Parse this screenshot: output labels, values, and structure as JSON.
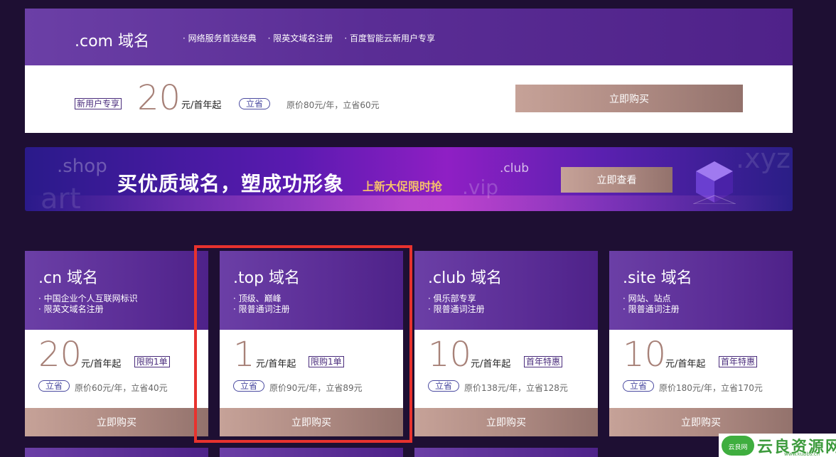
{
  "com_card": {
    "title": ".com 域名",
    "features": [
      "网络服务首选经典",
      "限英文域名注册",
      "百度智能云新用户专享"
    ],
    "badge": "新用户专享",
    "price": "20",
    "unit": "元/首年起",
    "save_label": "立省",
    "original": "原价80元/年，立省60元",
    "buy_label": "立即购买"
  },
  "banner": {
    "title": "买优质域名，塑成功形象",
    "subtitle": "上新大促限时抢",
    "button_label": "立即查看",
    "ghost_texts": [
      ".shop",
      "art",
      ".vip",
      ".club",
      ".xyz"
    ]
  },
  "cards": [
    {
      "title": ".cn 域名",
      "features": [
        "中国企业个人互联网标识",
        "限英文域名注册"
      ],
      "price": "20",
      "unit": "元/首年起",
      "badge": "限购1单",
      "save_label": "立省",
      "original": "原价60元/年，立省40元",
      "buy_label": "立即购买"
    },
    {
      "title": ".top 域名",
      "features": [
        "顶级、巅峰",
        "限普通词注册"
      ],
      "price": "1",
      "unit": "元/首年起",
      "badge": "限购1单",
      "save_label": "立省",
      "original": "原价90元/年，立省89元",
      "buy_label": "立即购买"
    },
    {
      "title": ".club 域名",
      "features": [
        "俱乐部专享",
        "限普通词注册"
      ],
      "price": "10",
      "unit": "元/首年起",
      "badge": "首年特惠",
      "save_label": "立省",
      "original": "原价138元/年，立省128元",
      "buy_label": "立即购买"
    },
    {
      "title": ".site 域名",
      "features": [
        "网站、站点",
        "限普通词注册"
      ],
      "price": "10",
      "unit": "元/首年起",
      "badge": "首年特惠",
      "save_label": "立省",
      "original": "原价180元/年，立省170元",
      "buy_label": "立即购买"
    }
  ],
  "watermark": {
    "text": "云良资源网",
    "cloud": "云良网",
    "url": "www.kubbs.cn"
  },
  "colors": {
    "accent_purple": "#5a2d95",
    "price": "#a78178",
    "selection": "#e8322e"
  }
}
